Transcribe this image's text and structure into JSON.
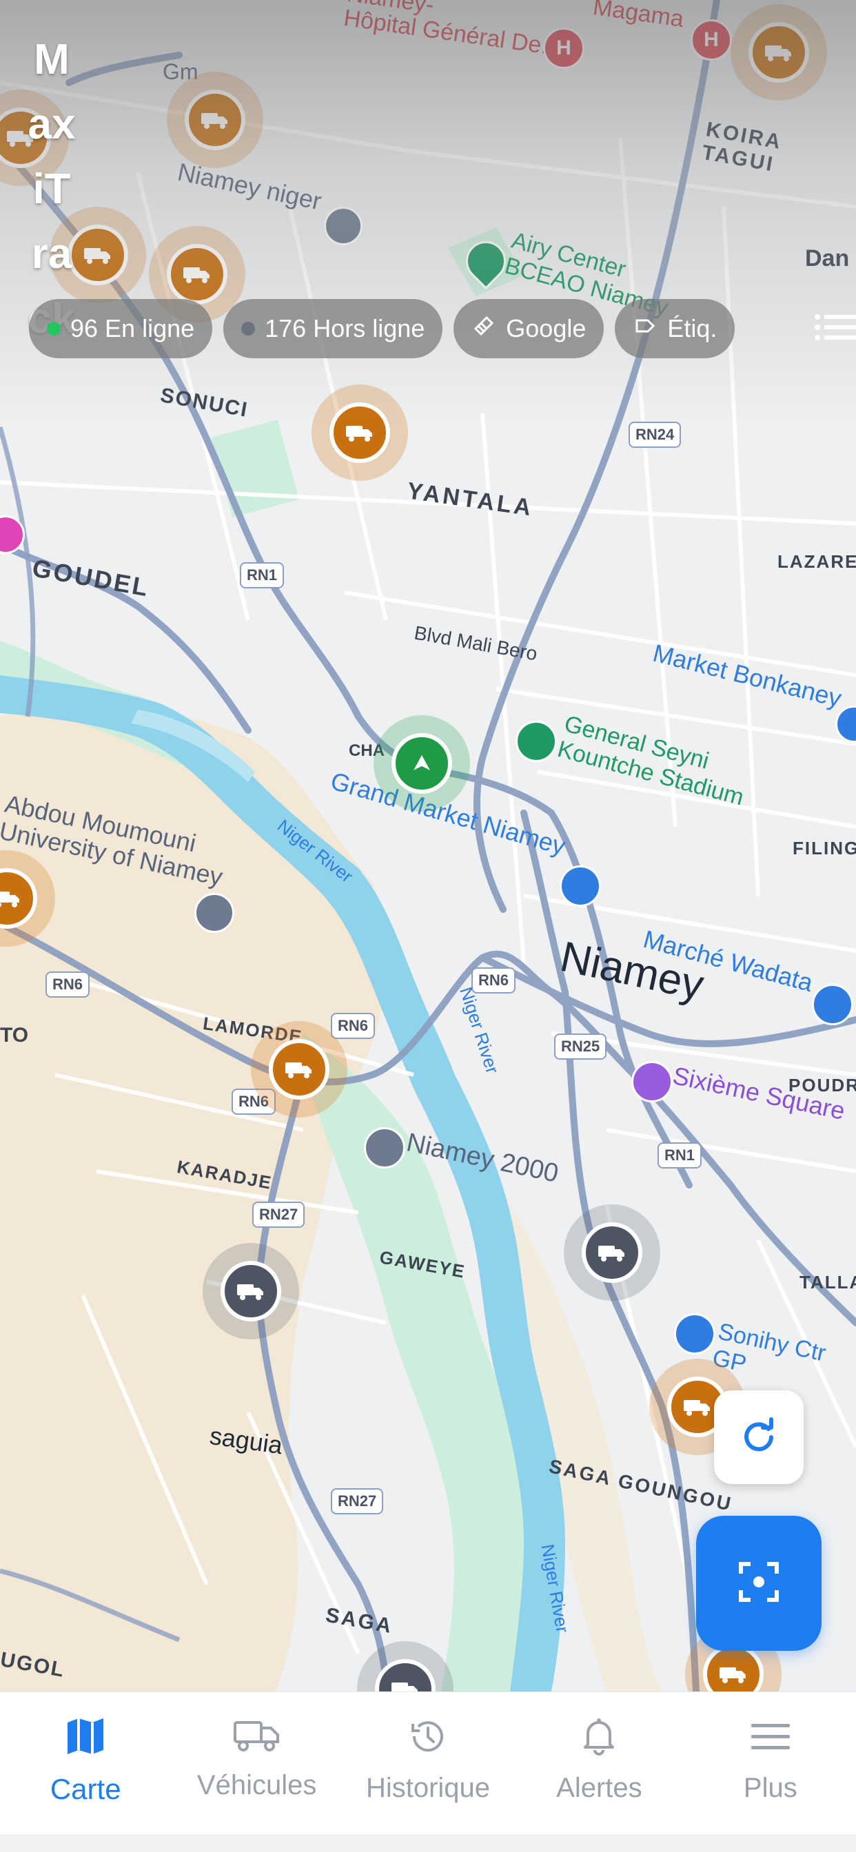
{
  "app": {
    "title": "MaxiTrack"
  },
  "status_chips": {
    "online": {
      "label": "96 En ligne",
      "color": "#22c55e"
    },
    "offline": {
      "label": "176 Hors ligne",
      "color": "#6b7280"
    },
    "map_type": {
      "label": "Google",
      "icon": "map-layers-icon"
    },
    "labels": {
      "label": "Étiq.",
      "icon": "tag-icon"
    },
    "list_icon": "list-icon"
  },
  "map": {
    "places": {
      "hospital_1": "Niamey-\nHôpital Général De...",
      "hospital_2": "Magama",
      "koira_tagui": "KOIRA TAGUI",
      "dan": "Dan",
      "niamey_niger": "Niamey niger",
      "gm": "Gm",
      "airy_center": "Airy Center\nBCEAO Niamey",
      "sonuci": "SONUCI",
      "rn24": "RN24",
      "yantala": "YANTALA",
      "lazaret": "LAZARET",
      "goudel": "GOUDEL",
      "rn1_a": "RN1",
      "blvd_mali_bero": "Blvd Mali Bero",
      "market_bonkaney": "Market Bonkaney",
      "general_seyni": "General Seyni\nKountche Stadium",
      "grand_market": "Grand Market Niamey",
      "filingue": "FILINGUE",
      "abdou_moumouni": "Abdou Moumouni\nUniversity of Niamey",
      "niger_river_1": "Niger River",
      "niamey": "Niamey",
      "marche_wadata": "Marché Wadata",
      "rn6_a": "RN6",
      "rn6_b": "RN6",
      "rn6_c": "RN6",
      "rn6_d": "RN6",
      "rn25": "RN25",
      "rn1_b": "RN1",
      "niger_river_2": "Niger River",
      "lamorde": "LAMORDE",
      "sixieme_square": "Sixième Square",
      "poudriere": "POUDRIERE",
      "karadje": "KARADJE",
      "rn27_a": "RN27",
      "niamey_2000": "Niamey 2000",
      "gaweye": "GAWEYE",
      "talladje": "TALLADJE",
      "sonihy": "Sonihy Ctr GP",
      "saguia": "saguia",
      "saga_goungou": "SAGA GOUNGOU",
      "rn27_b": "RN27",
      "saga": "SAGA",
      "niger_river_3": "Niger River",
      "ugol": "UGOL",
      "to": "TO",
      "cha": "CHA"
    }
  },
  "buttons": {
    "refresh_icon": "refresh-icon",
    "fit_icon": "focus-icon"
  },
  "bottom_nav": [
    {
      "label": "Carte",
      "icon": "map-icon",
      "active": true
    },
    {
      "label": "Véhicules",
      "icon": "truck-icon",
      "active": false
    },
    {
      "label": "Historique",
      "icon": "history-icon",
      "active": false
    },
    {
      "label": "Alertes",
      "icon": "bell-icon",
      "active": false
    },
    {
      "label": "Plus",
      "icon": "menu-icon",
      "active": false
    }
  ],
  "colors": {
    "accent": "#1e7ef1",
    "online_marker": "#c8700f",
    "offline_marker": "#4d5563",
    "moving_marker": "#1f9a45",
    "road": "#8c9fc0",
    "river": "#8ed2ec",
    "park": "#cdeedc",
    "sand": "#f3e8d6"
  }
}
